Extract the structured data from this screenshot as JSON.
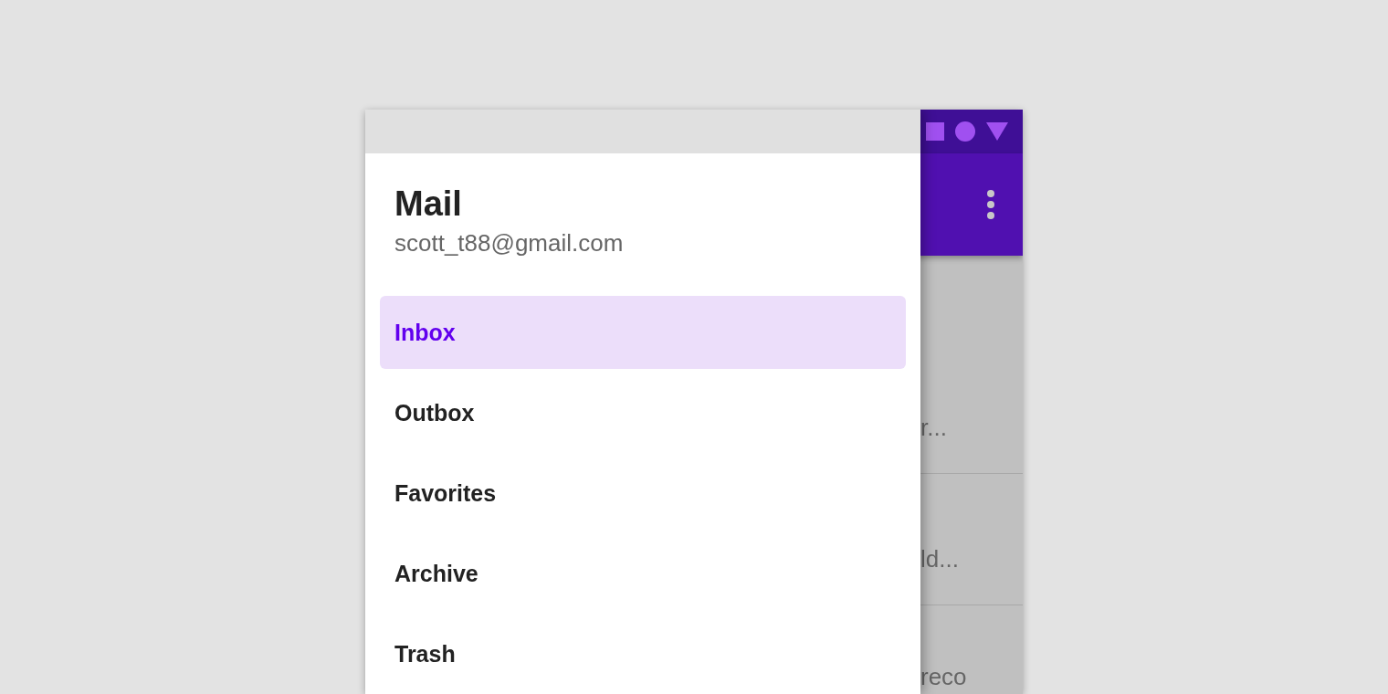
{
  "app_bar": {
    "status_icons": [
      {
        "kind": "square"
      },
      {
        "kind": "circle"
      },
      {
        "kind": "triangle"
      }
    ]
  },
  "background_list": [
    {
      "snippet": "r..."
    },
    {
      "snippet": "ld..."
    },
    {
      "snippet": "reco"
    }
  ],
  "drawer": {
    "title": "Mail",
    "subtitle": "scott_t88@gmail.com",
    "items": [
      {
        "label": "Inbox",
        "selected": true
      },
      {
        "label": "Outbox",
        "selected": false
      },
      {
        "label": "Favorites",
        "selected": false
      },
      {
        "label": "Archive",
        "selected": false
      },
      {
        "label": "Trash",
        "selected": false
      }
    ]
  }
}
